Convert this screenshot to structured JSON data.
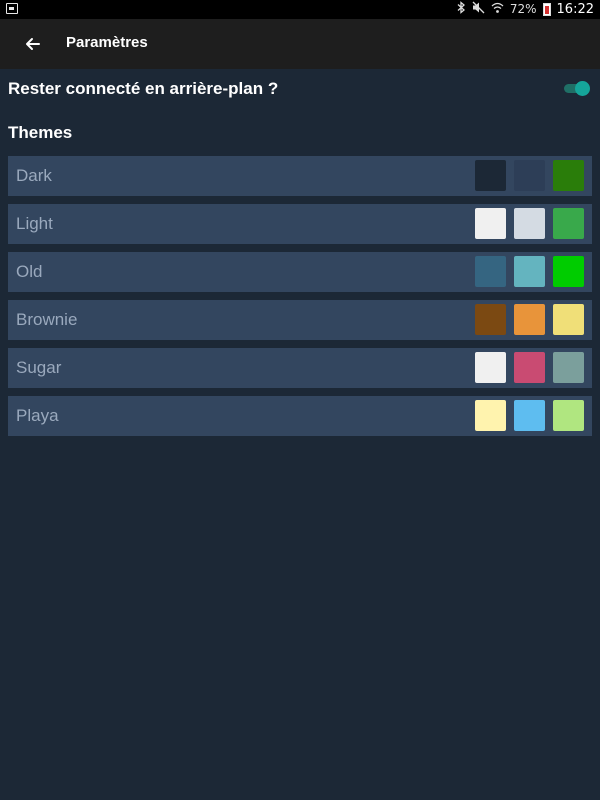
{
  "status_bar": {
    "battery": "72%",
    "time": "16:22",
    "icons": [
      "gallery-icon",
      "bluetooth-icon",
      "mute-icon",
      "wifi-icon",
      "battery-icon"
    ]
  },
  "app_bar": {
    "title": "Paramètres",
    "back_icon": "arrow-left-icon"
  },
  "settings": {
    "background_label": "Rester connecté en arrière-plan ?",
    "background_enabled": true,
    "toggle_color": "#15a59a"
  },
  "themes": {
    "title": "Themes",
    "items": [
      {
        "name": "Dark",
        "colors": [
          "#1c2836",
          "#2d3e57",
          "#2a7d0a"
        ]
      },
      {
        "name": "Light",
        "colors": [
          "#f0f0f0",
          "#d4dbe3",
          "#39a94b"
        ]
      },
      {
        "name": "Old",
        "colors": [
          "#356581",
          "#64b4bf",
          "#00cc00"
        ]
      },
      {
        "name": "Brownie",
        "colors": [
          "#7b4912",
          "#e8943a",
          "#f0df78"
        ]
      },
      {
        "name": "Sugar",
        "colors": [
          "#f0f0f0",
          "#c94b72",
          "#7b9f9c"
        ]
      },
      {
        "name": "Playa",
        "colors": [
          "#fff3ae",
          "#5ebdf0",
          "#b0e680"
        ]
      }
    ]
  }
}
